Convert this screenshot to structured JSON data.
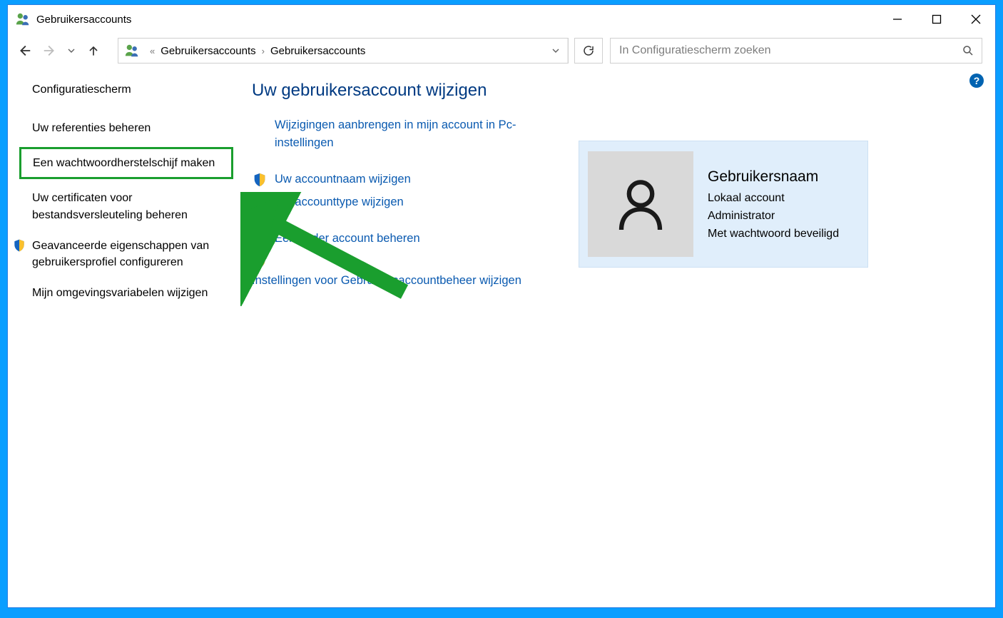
{
  "window": {
    "title": "Gebruikersaccounts"
  },
  "breadcrumb": {
    "items": [
      "Gebruikersaccounts",
      "Gebruikersaccounts"
    ]
  },
  "search": {
    "placeholder": "In Configuratiescherm zoeken"
  },
  "sidebar": {
    "home": "Configuratiescherm",
    "items": [
      {
        "label": "Uw referenties beheren",
        "shield": false,
        "highlight": false
      },
      {
        "label": "Een wachtwoordherstelschijf maken",
        "shield": false,
        "highlight": true
      },
      {
        "label": "Uw certificaten voor bestandsversleuteling beheren",
        "shield": false,
        "highlight": false
      },
      {
        "label": "Geavanceerde eigenschappen van gebruikersprofiel configureren",
        "shield": true,
        "highlight": false
      },
      {
        "label": "Mijn omgevingsvariabelen wijzigen",
        "shield": false,
        "highlight": false
      }
    ]
  },
  "main": {
    "heading": "Uw gebruikersaccount wijzigen",
    "links": [
      {
        "label": "Wijzigingen aanbrengen in mijn account in Pc-instellingen",
        "shield": false
      },
      {
        "label": "Uw accountnaam wijzigen",
        "shield": true
      },
      {
        "label": "Uw accounttype wijzigen",
        "shield": true
      },
      {
        "label": "Een ander account beheren",
        "shield": true
      },
      {
        "label": "Instellingen voor Gebruikersaccountbeheer wijzigen",
        "shield": true
      }
    ]
  },
  "account": {
    "name": "Gebruikersnaam",
    "type": "Lokaal account",
    "role": "Administrator",
    "pwstatus": "Met wachtwoord beveiligd"
  },
  "help_badge": "?"
}
